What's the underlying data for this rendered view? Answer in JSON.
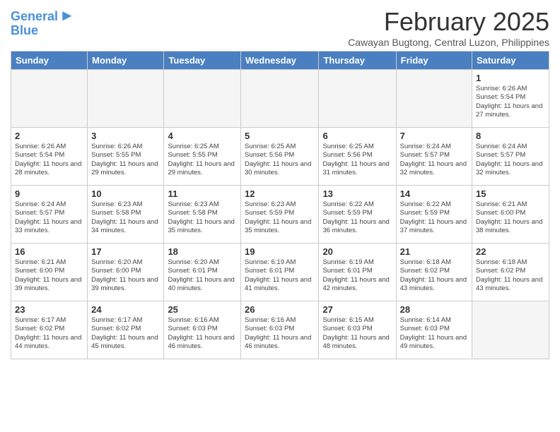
{
  "header": {
    "logo_line1": "General",
    "logo_line2": "Blue",
    "month": "February 2025",
    "location": "Cawayan Bugtong, Central Luzon, Philippines"
  },
  "weekdays": [
    "Sunday",
    "Monday",
    "Tuesday",
    "Wednesday",
    "Thursday",
    "Friday",
    "Saturday"
  ],
  "weeks": [
    [
      {
        "num": "",
        "info": ""
      },
      {
        "num": "",
        "info": ""
      },
      {
        "num": "",
        "info": ""
      },
      {
        "num": "",
        "info": ""
      },
      {
        "num": "",
        "info": ""
      },
      {
        "num": "",
        "info": ""
      },
      {
        "num": "1",
        "info": "Sunrise: 6:26 AM\nSunset: 5:54 PM\nDaylight: 11 hours and 27 minutes."
      }
    ],
    [
      {
        "num": "2",
        "info": "Sunrise: 6:26 AM\nSunset: 5:54 PM\nDaylight: 11 hours and 28 minutes."
      },
      {
        "num": "3",
        "info": "Sunrise: 6:26 AM\nSunset: 5:55 PM\nDaylight: 11 hours and 29 minutes."
      },
      {
        "num": "4",
        "info": "Sunrise: 6:25 AM\nSunset: 5:55 PM\nDaylight: 11 hours and 29 minutes."
      },
      {
        "num": "5",
        "info": "Sunrise: 6:25 AM\nSunset: 5:56 PM\nDaylight: 11 hours and 30 minutes."
      },
      {
        "num": "6",
        "info": "Sunrise: 6:25 AM\nSunset: 5:56 PM\nDaylight: 11 hours and 31 minutes."
      },
      {
        "num": "7",
        "info": "Sunrise: 6:24 AM\nSunset: 5:57 PM\nDaylight: 11 hours and 32 minutes."
      },
      {
        "num": "8",
        "info": "Sunrise: 6:24 AM\nSunset: 5:57 PM\nDaylight: 11 hours and 32 minutes."
      }
    ],
    [
      {
        "num": "9",
        "info": "Sunrise: 6:24 AM\nSunset: 5:57 PM\nDaylight: 11 hours and 33 minutes."
      },
      {
        "num": "10",
        "info": "Sunrise: 6:23 AM\nSunset: 5:58 PM\nDaylight: 11 hours and 34 minutes."
      },
      {
        "num": "11",
        "info": "Sunrise: 6:23 AM\nSunset: 5:58 PM\nDaylight: 11 hours and 35 minutes."
      },
      {
        "num": "12",
        "info": "Sunrise: 6:23 AM\nSunset: 5:59 PM\nDaylight: 11 hours and 35 minutes."
      },
      {
        "num": "13",
        "info": "Sunrise: 6:22 AM\nSunset: 5:59 PM\nDaylight: 11 hours and 36 minutes."
      },
      {
        "num": "14",
        "info": "Sunrise: 6:22 AM\nSunset: 5:59 PM\nDaylight: 11 hours and 37 minutes."
      },
      {
        "num": "15",
        "info": "Sunrise: 6:21 AM\nSunset: 6:00 PM\nDaylight: 11 hours and 38 minutes."
      }
    ],
    [
      {
        "num": "16",
        "info": "Sunrise: 6:21 AM\nSunset: 6:00 PM\nDaylight: 11 hours and 39 minutes."
      },
      {
        "num": "17",
        "info": "Sunrise: 6:20 AM\nSunset: 6:00 PM\nDaylight: 11 hours and 39 minutes."
      },
      {
        "num": "18",
        "info": "Sunrise: 6:20 AM\nSunset: 6:01 PM\nDaylight: 11 hours and 40 minutes."
      },
      {
        "num": "19",
        "info": "Sunrise: 6:19 AM\nSunset: 6:01 PM\nDaylight: 11 hours and 41 minutes."
      },
      {
        "num": "20",
        "info": "Sunrise: 6:19 AM\nSunset: 6:01 PM\nDaylight: 11 hours and 42 minutes."
      },
      {
        "num": "21",
        "info": "Sunrise: 6:18 AM\nSunset: 6:02 PM\nDaylight: 11 hours and 43 minutes."
      },
      {
        "num": "22",
        "info": "Sunrise: 6:18 AM\nSunset: 6:02 PM\nDaylight: 11 hours and 43 minutes."
      }
    ],
    [
      {
        "num": "23",
        "info": "Sunrise: 6:17 AM\nSunset: 6:02 PM\nDaylight: 11 hours and 44 minutes."
      },
      {
        "num": "24",
        "info": "Sunrise: 6:17 AM\nSunset: 6:02 PM\nDaylight: 11 hours and 45 minutes."
      },
      {
        "num": "25",
        "info": "Sunrise: 6:16 AM\nSunset: 6:03 PM\nDaylight: 11 hours and 46 minutes."
      },
      {
        "num": "26",
        "info": "Sunrise: 6:16 AM\nSunset: 6:03 PM\nDaylight: 11 hours and 46 minutes."
      },
      {
        "num": "27",
        "info": "Sunrise: 6:15 AM\nSunset: 6:03 PM\nDaylight: 11 hours and 48 minutes."
      },
      {
        "num": "28",
        "info": "Sunrise: 6:14 AM\nSunset: 6:03 PM\nDaylight: 11 hours and 49 minutes."
      },
      {
        "num": "",
        "info": ""
      }
    ]
  ]
}
